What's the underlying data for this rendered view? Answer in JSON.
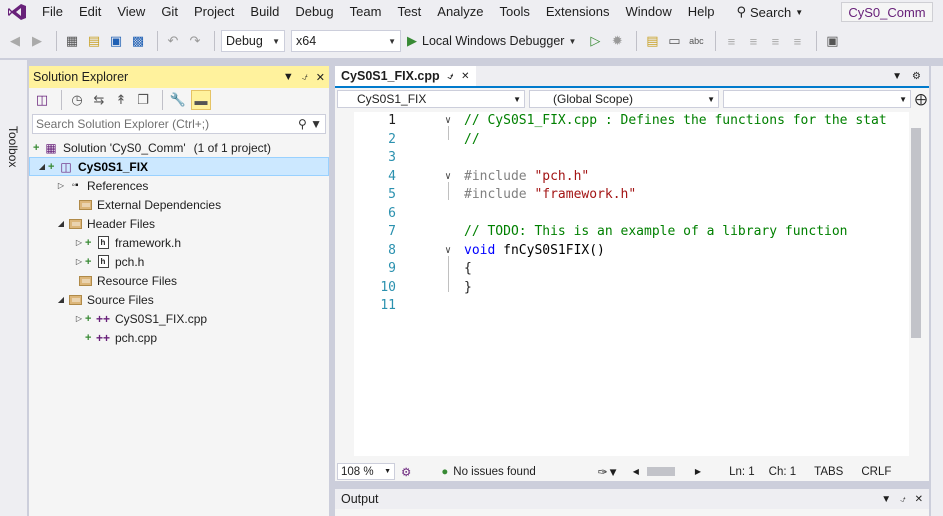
{
  "menu": {
    "items": [
      "File",
      "Edit",
      "View",
      "Git",
      "Project",
      "Build",
      "Debug",
      "Team",
      "Test",
      "Analyze",
      "Tools",
      "Extensions",
      "Window",
      "Help"
    ],
    "search_label": "Search",
    "solution_title": "CyS0_Comm"
  },
  "toolbar": {
    "config": "Debug",
    "platform": "x64",
    "run_label": "Local Windows Debugger"
  },
  "toolbox": {
    "label": "Toolbox"
  },
  "solution_explorer": {
    "title": "Solution Explorer",
    "search_placeholder": "Search Solution Explorer (Ctrl+;)",
    "tree": [
      {
        "label": "Solution 'CyS0_Comm'",
        "suffix": "(1 of 1 project)"
      },
      {
        "label": "CyS0S1_FIX"
      },
      {
        "label": "References"
      },
      {
        "label": "External Dependencies"
      },
      {
        "label": "Header Files"
      },
      {
        "label": "framework.h"
      },
      {
        "label": "pch.h"
      },
      {
        "label": "Resource Files"
      },
      {
        "label": "Source Files"
      },
      {
        "label": "CyS0S1_FIX.cpp"
      },
      {
        "label": "pch.cpp"
      }
    ]
  },
  "editor": {
    "tab_label": "CyS0S1_FIX.cpp",
    "nav_project": "CyS0S1_FIX",
    "nav_scope": "(Global Scope)",
    "nav_member": "",
    "line_numbers": [
      "1",
      "2",
      "3",
      "4",
      "5",
      "6",
      "7",
      "8",
      "9",
      "10",
      "11"
    ],
    "code": {
      "l1": "// CyS0S1_FIX.cpp : Defines the functions for the stat",
      "l2": "//",
      "l4_dir": "#include",
      "l4_str": "\"pch.h\"",
      "l5_dir": "#include",
      "l5_str": "\"framework.h\"",
      "l7": "// TODO: This is an example of a library function",
      "l8_kw": "void",
      "l8_fn": "fnCyS0S1FIX()",
      "l9": "{",
      "l10": "}"
    }
  },
  "status": {
    "zoom": "108 %",
    "issues": "No issues found",
    "line": "Ln: 1",
    "col": "Ch: 1",
    "tabs": "TABS",
    "eol": "CRLF"
  },
  "output": {
    "title": "Output"
  },
  "colors": {
    "accent": "#007acc",
    "highlight": "#fff29d",
    "brand": "#68217a"
  }
}
